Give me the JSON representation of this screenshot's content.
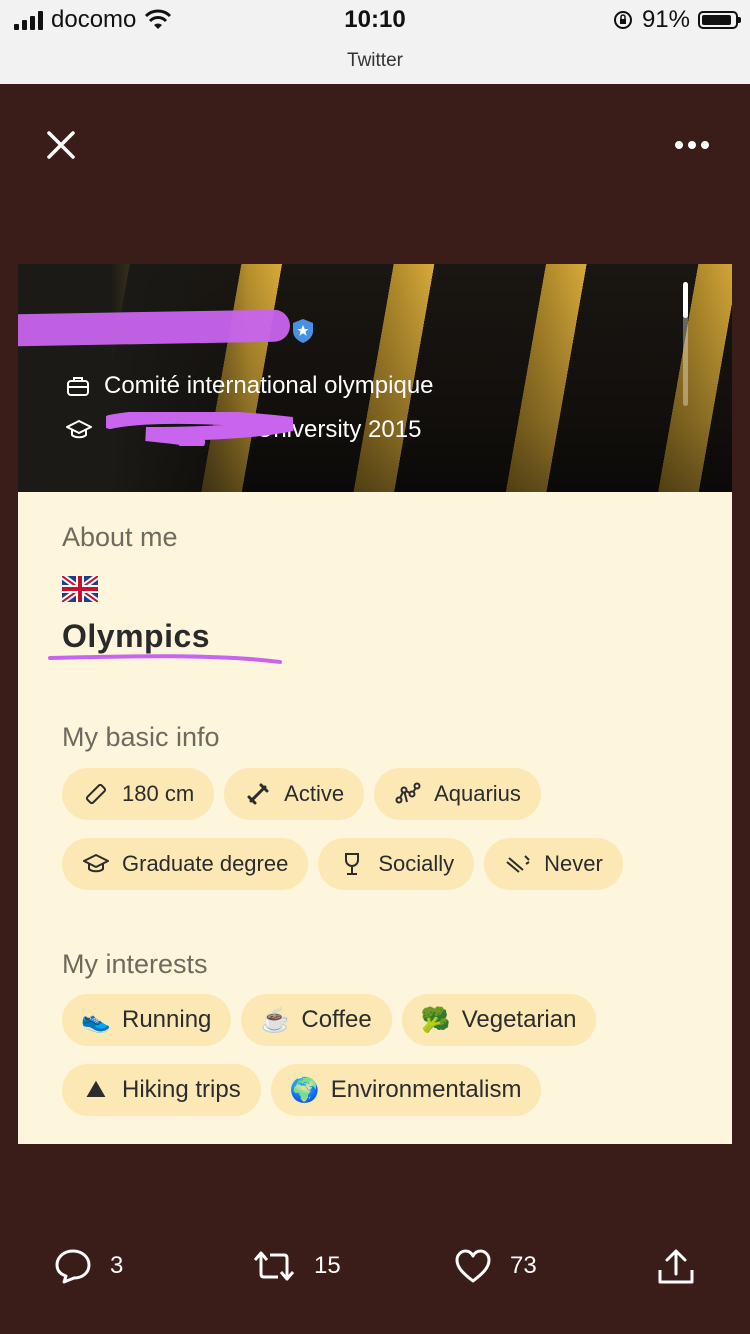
{
  "status_bar": {
    "carrier": "docomo",
    "time": "10:10",
    "battery": "91%",
    "battery_level": 0.91,
    "app_title": "Twitter"
  },
  "profile": {
    "work": "Comité international olympique",
    "education": "University 2015",
    "about_title": "About me",
    "flag_icon": "uk-flag-icon",
    "bio": "Olympics",
    "basic_info_title": "My basic info",
    "basic_info": [
      {
        "icon": "ruler-icon",
        "label": "180 cm"
      },
      {
        "icon": "dumbbell-icon",
        "label": "Active"
      },
      {
        "icon": "constellation-icon",
        "label": "Aquarius"
      },
      {
        "icon": "graduation-cap-icon",
        "label": "Graduate degree"
      },
      {
        "icon": "wine-glass-icon",
        "label": "Socially"
      },
      {
        "icon": "no-smoking-icon",
        "label": "Never"
      }
    ],
    "interests_title": "My interests",
    "interests": [
      {
        "emoji": "👟",
        "label": "Running"
      },
      {
        "emoji": "☕",
        "label": "Coffee"
      },
      {
        "emoji": "🥦",
        "label": "Vegetarian"
      },
      {
        "emoji": "⛰",
        "label": "Hiking trips"
      },
      {
        "emoji": "🌍",
        "label": "Environmentalism"
      }
    ]
  },
  "tweet_actions": {
    "replies": "3",
    "retweets": "15",
    "likes": "73"
  },
  "colors": {
    "viewer_bg": "#3a1d18",
    "card_bg": "#fdf6dc",
    "chip_bg": "#fbe8b4",
    "redaction": "#c864ee",
    "verified": "#4a90e2"
  }
}
